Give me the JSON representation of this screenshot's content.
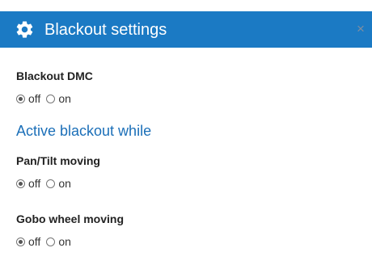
{
  "dialog": {
    "title": "Blackout settings",
    "title_icon": "gear-icon",
    "close_glyph": "×",
    "accent_color": "#1b7ac4"
  },
  "blackout_dmc": {
    "label": "Blackout DMC",
    "options": [
      "off",
      "on"
    ],
    "selected": "off"
  },
  "active_section": {
    "heading": "Active blackout while"
  },
  "pan_tilt": {
    "label": "Pan/Tilt moving",
    "options": [
      "off",
      "on"
    ],
    "selected": "off"
  },
  "gobo": {
    "label": "Gobo wheel moving",
    "options": [
      "off",
      "on"
    ],
    "selected": "off"
  }
}
